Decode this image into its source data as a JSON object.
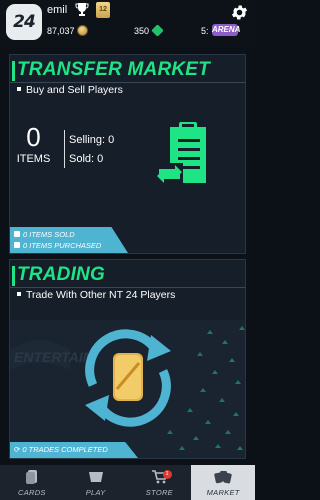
{
  "header": {
    "logo_text": "24",
    "username": "emil",
    "coins": "87,037",
    "gems": "350",
    "tier_count": "5:",
    "arena_label": "ARENA",
    "level_badge": "12"
  },
  "transfer_market": {
    "title": "TRANSFER MARKET",
    "subtitle": "Buy and Sell Players",
    "items_count": "0",
    "items_label": "ITEMS",
    "selling": "Selling: 0",
    "sold": "Sold: 0",
    "items_sold": "0 ITEMS SOLD",
    "items_purchased": "0 ITEMS PURCHASED"
  },
  "trading": {
    "title": "TRADING",
    "subtitle": "Trade With Other NT 24 Players",
    "trades_completed": "0 TRADES COMPLETED"
  },
  "nav": {
    "items": [
      {
        "label": "CARDS",
        "icon": "cards-icon"
      },
      {
        "label": "PLAY",
        "icon": "play-icon"
      },
      {
        "label": "STORE",
        "icon": "cart-icon",
        "badge": "1"
      },
      {
        "label": "MARKET",
        "icon": "market-icon",
        "active": true
      }
    ]
  },
  "colors": {
    "accent_green": "#1ee486",
    "strip_blue": "#4fb3d2",
    "arena_purple": "#8c5cc9"
  }
}
